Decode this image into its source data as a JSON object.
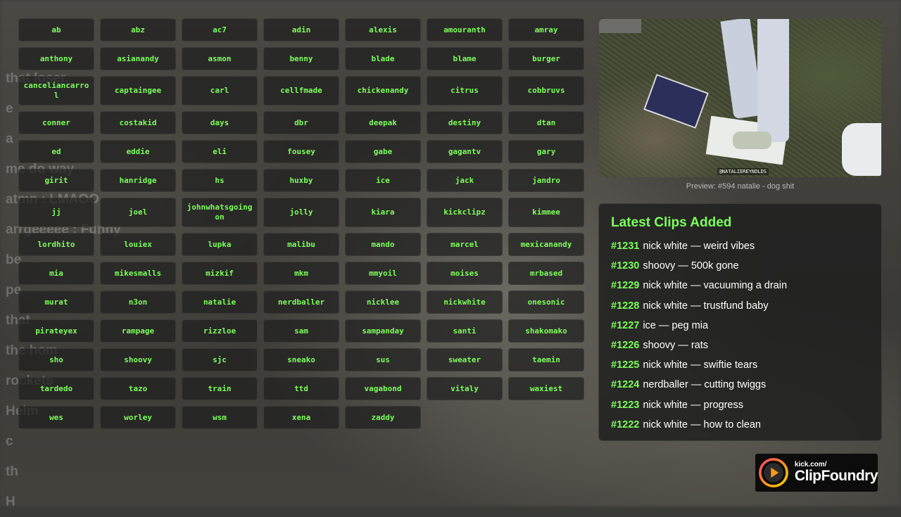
{
  "streamers": [
    "ab",
    "abz",
    "ac7",
    "adin",
    "alexis",
    "amouranth",
    "amray",
    "anthony",
    "asianandy",
    "asmon",
    "benny",
    "blade",
    "blame",
    "burger",
    "canceliancarrol",
    "captaingee",
    "carl",
    "cellfmade",
    "chickenandy",
    "citrus",
    "cobbruvs",
    "conner",
    "costakid",
    "days",
    "dbr",
    "deepak",
    "destiny",
    "dtan",
    "ed",
    "eddie",
    "eli",
    "fousey",
    "gabe",
    "gagantv",
    "gary",
    "girit",
    "hanridge",
    "hs",
    "huxby",
    "ice",
    "jack",
    "jandro",
    "jj",
    "joel",
    "johnwhatsgoingon",
    "jolly",
    "kiara",
    "kickclipz",
    "kimmee",
    "lordhito",
    "louiex",
    "lupka",
    "malibu",
    "mando",
    "marcel",
    "mexicanandy",
    "mia",
    "mikesmalls",
    "mizkif",
    "mkm",
    "mmyoil",
    "moises",
    "mrbased",
    "murat",
    "n3on",
    "natalie",
    "nerdballer",
    "nicklee",
    "nickwhite",
    "onesonic",
    "pirateyex",
    "rampage",
    "rizzloe",
    "sam",
    "sampanday",
    "santi",
    "shakomako",
    "sho",
    "shoovy",
    "sjc",
    "sneako",
    "sus",
    "sweater",
    "taemin",
    "tardedo",
    "tazo",
    "train",
    "ttd",
    "vagabond",
    "vitaly",
    "waxiest",
    "wes",
    "worley",
    "wsm",
    "xena",
    "zaddy"
  ],
  "preview": {
    "caption": "Preview: #594 natalie - dog shit",
    "watermark": "@NATALIEREYNOLDS"
  },
  "latest": {
    "title": "Latest Clips Added",
    "clips": [
      {
        "num": "#1231",
        "text": "nick white — weird vibes"
      },
      {
        "num": "#1230",
        "text": "shoovy — 500k gone"
      },
      {
        "num": "#1229",
        "text": "nick white — vacuuming a drain"
      },
      {
        "num": "#1228",
        "text": "nick white — trustfund baby"
      },
      {
        "num": "#1227",
        "text": "ice — peg mia"
      },
      {
        "num": "#1226",
        "text": "shoovy — rats"
      },
      {
        "num": "#1225",
        "text": "nick white — swiftie tears"
      },
      {
        "num": "#1224",
        "text": "nerdballer — cutting twiggs"
      },
      {
        "num": "#1223",
        "text": "nick white — progress"
      },
      {
        "num": "#1222",
        "text": "nick white — how to clean"
      }
    ]
  },
  "logo": {
    "small": "kick.com/",
    "big": "ClipFoundry"
  },
  "background_chat": [
    "that loser.",
    "e",
    "a",
    "me do way",
    "atmn : LMAOO",
    "arrgeeeee : Funny",
    "be",
    "pe",
    "that",
    "the hom",
    "rockets",
    "Helm",
    "c",
    "th",
    "H"
  ],
  "colors": {
    "accent": "#7dff5a",
    "panel": "#202120",
    "text": "#ffffff"
  }
}
